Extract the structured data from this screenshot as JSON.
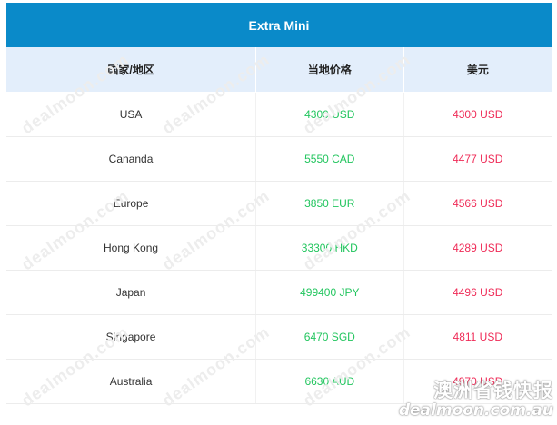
{
  "table": {
    "title": "Extra Mini",
    "headers": [
      "国家/地区",
      "当地价格",
      "美元"
    ],
    "rows": [
      {
        "country": "USA",
        "local": "4300 USD",
        "usd": "4300 USD"
      },
      {
        "country": "Cananda",
        "local": "5550 CAD",
        "usd": "4477 USD"
      },
      {
        "country": "Europe",
        "local": "3850 EUR",
        "usd": "4566 USD"
      },
      {
        "country": "Hong Kong",
        "local": "33300 HKD",
        "usd": "4289 USD"
      },
      {
        "country": "Japan",
        "local": "499400 JPY",
        "usd": "4496 USD"
      },
      {
        "country": "Singapore",
        "local": "6470 SGD",
        "usd": "4811 USD"
      },
      {
        "country": "Australia",
        "local": "6630 AUD",
        "usd": "4970 USD"
      }
    ]
  },
  "watermark": {
    "text": "dealmoon.com",
    "brand_cn": "澳洲省钱快报",
    "brand_en": "dealmoon.com.au"
  },
  "colors": {
    "header_bg": "#0a8ac9",
    "subheader_bg": "#e3eefb",
    "local_price": "#22c55e",
    "usd_price": "#ef2b57"
  }
}
